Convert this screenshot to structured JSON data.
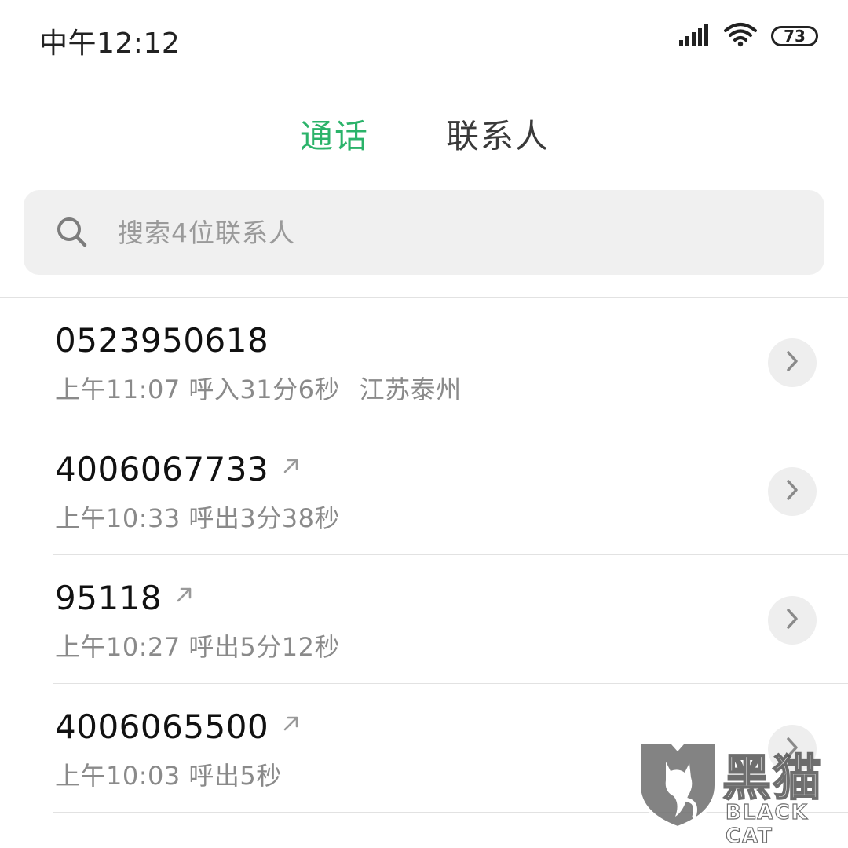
{
  "status_bar": {
    "time": "中午12:12",
    "battery": "73",
    "icons": [
      "signal-icon",
      "wifi-icon",
      "battery-icon"
    ]
  },
  "tabs": [
    {
      "label": "通话",
      "active": true
    },
    {
      "label": "联系人",
      "active": false
    }
  ],
  "colors": {
    "accent": "#2bb36a",
    "secondary_text": "#8a8a8a",
    "divider": "#e2e2e2",
    "search_bg": "#f0f0f0"
  },
  "search": {
    "placeholder": "搜索4位联系人",
    "value": ""
  },
  "calls": [
    {
      "number": "0523950618",
      "outgoing": false,
      "time": "上午11:07",
      "direction_duration": "呼入31分6秒",
      "location": "江苏泰州"
    },
    {
      "number": "4006067733",
      "outgoing": true,
      "time": "上午10:33",
      "direction_duration": "呼出3分38秒",
      "location": ""
    },
    {
      "number": "95118",
      "outgoing": true,
      "time": "上午10:27",
      "direction_duration": "呼出5分12秒",
      "location": ""
    },
    {
      "number": "4006065500",
      "outgoing": true,
      "time": "上午10:03",
      "direction_duration": "呼出5秒",
      "location": ""
    }
  ],
  "watermark": {
    "cn": "黑猫",
    "en": "BLACK CAT"
  }
}
